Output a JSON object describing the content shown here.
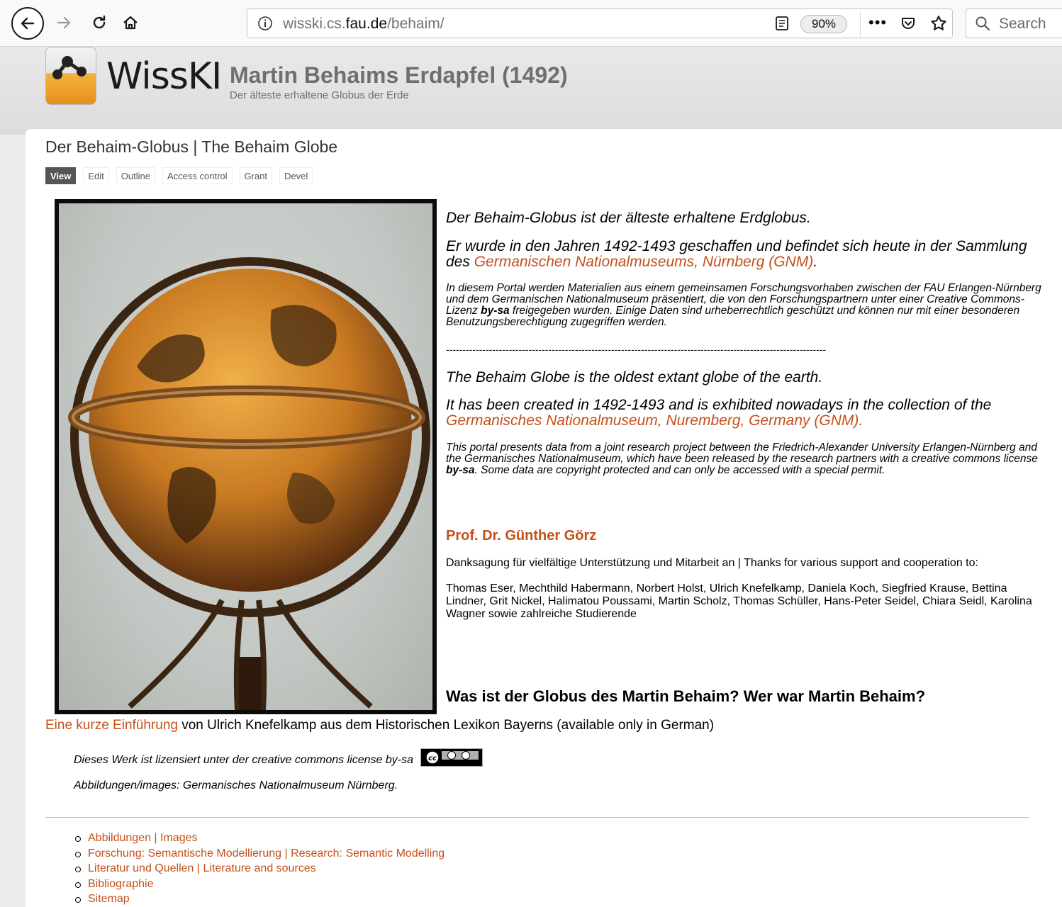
{
  "browser": {
    "url_prefix": "wisski.cs.",
    "url_domain": "fau.de",
    "url_path": "/behaim/",
    "zoom": "90%",
    "search_placeholder": "Search"
  },
  "header": {
    "logo_text": "WissKI",
    "site_name": "Martin Behaims Erdapfel (1492)",
    "slogan": "Der älteste erhaltene Globus der Erde"
  },
  "page": {
    "title": "Der Behaim-Globus | The Behaim Globe",
    "tabs": [
      "View",
      "Edit",
      "Outline",
      "Access control",
      "Grant",
      "Devel"
    ]
  },
  "body": {
    "de_1": "Der Behaim-Globus ist der älteste erhaltene Erdglobus.",
    "de_2_text": "Er wurde in den Jahren 1492-1493 geschaffen und befindet sich heute in der Sammlung des ",
    "de_2_link": "Germanischen Nationalmuseums, Nürnberg (GNM)",
    "de_2_end": ".",
    "de_3_a": "In diesem Portal werden Materialien aus einem gemeinsamen Forschungsvorhaben zwischen der FAU Erlangen-Nürnberg und dem Germanischen Nationalmuseum präsentiert, die von den Forschungspartnern unter einer Creative Commons-Lizenz ",
    "de_3_bold": "by-sa",
    "de_3_b": " freigegeben wurden. Einige Daten sind urheberrechtlich geschützt und können nur mit einer besonderen Benutzungsberechtigung zugegriffen werden.",
    "divider": "-------------------------------------------------------------------------------------------------------------------",
    "en_1": "The Behaim Globe is the oldest extant globe of the earth.",
    "en_2_text": "It has been created in 1492-1493 and is exhibited nowadays in the collection of the ",
    "en_2_link": "Germanisches Nationalmuseum, Nuremberg, Germany (GNM).",
    "en_3_a": "This portal presents data from a joint research project between the Friedrich-Alexander University Erlangen-Nürnberg and the Germanisches Nationalmuseum, which have been released by the research partners with a creative commons license ",
    "en_3_bold": "by-sa",
    "en_3_b": ".  Some data are copyright protected and can only be accessed with a special permit.",
    "author": "Prof. Dr. Günther Görz",
    "thanks_label": "Danksagung für vielfältige Unterstützung und Mitarbeit an | Thanks for various support and cooperation to:",
    "thanks_names": "Thomas Eser, Mechthild Habermann, Norbert Holst, Ulrich Knefelkamp, Daniela Koch, Siegfried Krause, Bettina Lindner, Grit Nickel, Halimatou Poussami, Martin Scholz, Thomas Schüller, Hans-Peter Seidel, Chiara Seidl, Karolina Wagner sowie zahlreiche Studierende",
    "question": "Was ist der Globus des Martin Behaim? Wer war Martin Behaim?",
    "intro_link": "Eine kurze Einführung",
    "intro_rest": " von Ulrich Knefelkamp aus dem Historischen Lexikon Bayerns (available only in German)",
    "license_text": "Dieses Werk ist lizensiert unter der creative commons license by-sa",
    "images_credit": "Abbildungen/images: Germanisches Nationalmuseum Nürnberg."
  },
  "footer_links": [
    "Abbildungen | Images",
    "Forschung: Semantische Modellierung | Research: Semantic Modelling",
    "Literatur und Quellen | Literature and sources",
    "Bibliographie",
    "Sitemap"
  ]
}
